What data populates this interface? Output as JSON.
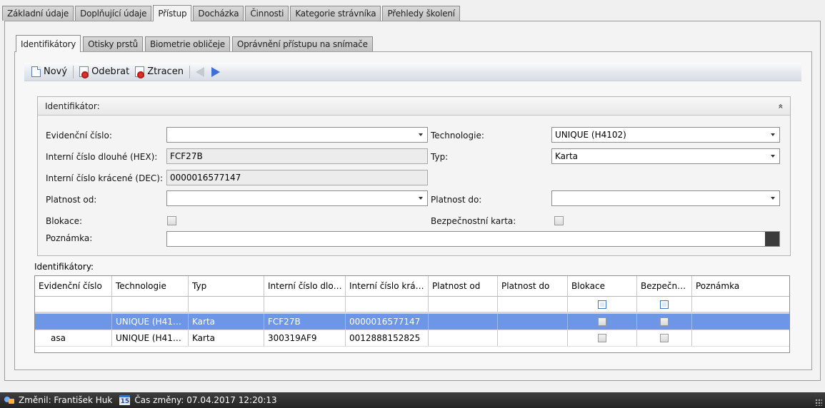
{
  "outer_tabs": [
    {
      "label": "Základní údaje",
      "active": false
    },
    {
      "label": "Doplňující údaje",
      "active": false
    },
    {
      "label": "Přístup",
      "active": true
    },
    {
      "label": "Docházka",
      "active": false
    },
    {
      "label": "Činnosti",
      "active": false
    },
    {
      "label": "Kategorie strávníka",
      "active": false
    },
    {
      "label": "Přehledy školení",
      "active": false
    }
  ],
  "inner_tabs": [
    {
      "label": "Identifikátory",
      "active": true
    },
    {
      "label": "Otisky prstů",
      "active": false
    },
    {
      "label": "Biometrie obličeje",
      "active": false
    },
    {
      "label": "Oprávnění přístupu na snímače",
      "active": false
    }
  ],
  "toolbar": {
    "new_label": "Nový",
    "remove_label": "Odebrat",
    "lost_label": "Ztracen"
  },
  "group": {
    "title": "Identifikátor:",
    "collapse_glyph": "»"
  },
  "form": {
    "evidencni_cislo": {
      "label": "Evidenční číslo:",
      "value": ""
    },
    "interni_hex": {
      "label": "Interní číslo dlouhé (HEX):",
      "value": "FCF27B"
    },
    "interni_dec": {
      "label": "Interní číslo krácené (DEC):",
      "value": "0000016577147"
    },
    "platnost_od": {
      "label": "Platnost od:",
      "value": ""
    },
    "blokace": {
      "label": "Blokace:",
      "checked": false
    },
    "poznamka": {
      "label": "Poznámka:",
      "value": ""
    },
    "technologie": {
      "label": "Technologie:",
      "value": "UNIQUE (H4102)"
    },
    "typ": {
      "label": "Typ:",
      "value": "Karta"
    },
    "platnost_do": {
      "label": "Platnost do:",
      "value": ""
    },
    "bezpecnostni_karta": {
      "label": "Bezpečnostní karta:",
      "checked": false
    }
  },
  "grid": {
    "label": "Identifikátory:",
    "columns": [
      "Evidenční číslo",
      "Technologie",
      "Typ",
      "Interní číslo dlo…",
      "Interní číslo krá…",
      "Platnost od",
      "Platnost do",
      "Blokace",
      "Bezpečn…",
      "Poznámka"
    ],
    "rows": [
      {
        "evidencni": "",
        "technologie": "UNIQUE (H41…",
        "typ": "Karta",
        "hex": "FCF27B",
        "dec": "0000016577147",
        "od": "",
        "do": "",
        "selected": true
      },
      {
        "evidencni": "asa",
        "technologie": "UNIQUE (H41…",
        "typ": "Karta",
        "hex": "300319AF9",
        "dec": "0012888152825",
        "od": "",
        "do": "",
        "selected": false
      }
    ]
  },
  "status": {
    "changed_by": "Změnil: František Huk",
    "calendar_icon_text": "15",
    "changed_at": "Čas změny: 07.04.2017 12:20:13"
  }
}
